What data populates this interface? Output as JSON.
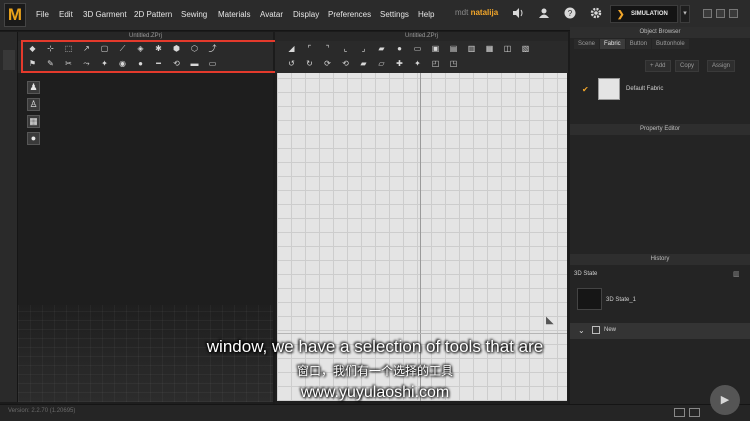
{
  "menubar": {
    "logo": "M",
    "items": [
      "File",
      "Edit",
      "3D Garment",
      "2D Pattern",
      "Sewing",
      "Materials",
      "Avatar",
      "Display",
      "Preferences",
      "Settings",
      "Help"
    ],
    "user_prefix": "mdt",
    "user_name": "natalija",
    "mode_label": "SIMULATION",
    "mode_symbol": "❯",
    "mode_dropdown": "▾"
  },
  "panel3d": {
    "title": "Untitled.ZPrj"
  },
  "panel2d": {
    "title": "Untitled.ZPrj"
  },
  "toolbars": {
    "tools3d_row1": [
      "◆",
      "⊹",
      "⬚",
      "↗",
      "▢",
      "⟋",
      "◈",
      "✱",
      "⬢",
      "⬡",
      "⤴"
    ],
    "tools3d_row2": [
      "⚑",
      "✎",
      "✂",
      "⤳",
      "✦",
      "◉",
      "●",
      "━",
      "⟲",
      "▬",
      "▭"
    ],
    "tools2d_row1": [
      "◢",
      "⌜",
      "⌝",
      "⌞",
      "⌟",
      "▰",
      "●",
      "▭",
      "▣",
      "▤",
      "▥",
      "▦",
      "◫",
      "▧"
    ],
    "tools2d_row2": [
      "↺",
      "↻",
      "⟳",
      "⟲",
      "▰",
      "▱",
      "✚",
      "✦",
      "◰",
      "◳"
    ]
  },
  "avatar_icons": [
    "♟",
    "♙",
    "▦",
    "●"
  ],
  "right_panel": {
    "object_browser": {
      "title": "Object Browser",
      "tabs": [
        "Scene",
        "Fabric",
        "Button",
        "Buttonhole"
      ],
      "active_tab": "Fabric",
      "buttons": [
        "+ Add",
        "Copy",
        "Assign"
      ],
      "fabric_item": "Default Fabric",
      "fabric_checked": "✔"
    },
    "property_editor": {
      "title": "Property Editor"
    },
    "history": {
      "title": "History",
      "section": "3D State",
      "state_item": "3D State_1",
      "new_label": "New"
    }
  },
  "statusbar": {
    "version": "Version: 2.2.70    (1.20695)"
  },
  "subtitles": {
    "line1": "window, we have a selection of tools that are",
    "line2": "窗口，我们有一个选择的工具",
    "line3": "www.yuyulaoshi.com"
  },
  "colors": {
    "accent": "#f2a62a",
    "highlight_box": "#e43a2c",
    "canvas_bg": "#e4e4e4"
  }
}
